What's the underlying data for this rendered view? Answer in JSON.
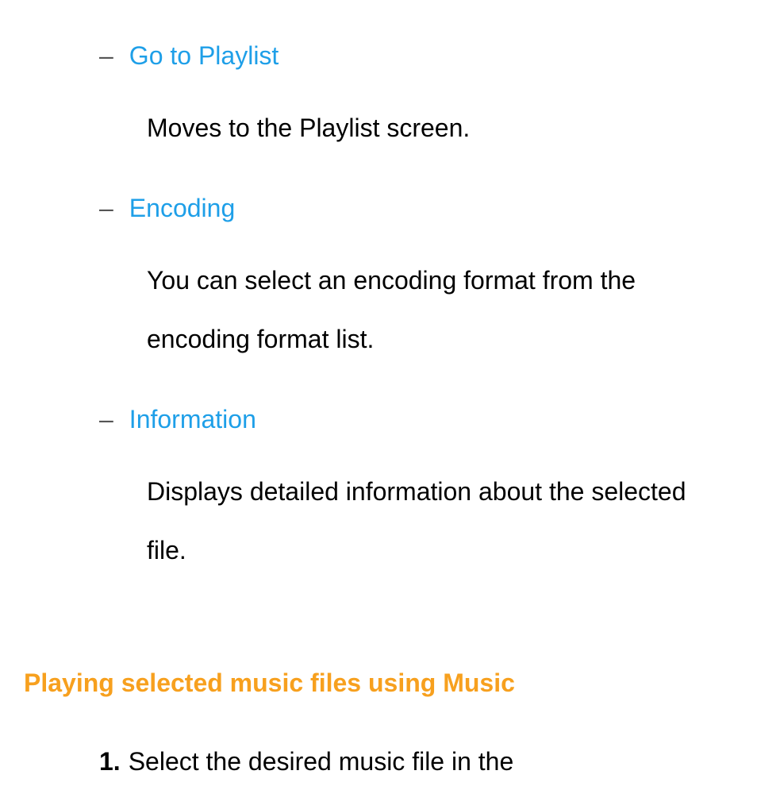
{
  "items": [
    {
      "title": "Go to Playlist",
      "description": "Moves to the Playlist screen."
    },
    {
      "title": "Encoding",
      "description": "You can select an encoding format from the encoding format list."
    },
    {
      "title": "Information",
      "description": "Displays detailed information about the selected file."
    }
  ],
  "section_heading": "Playing selected music files using Music",
  "step": {
    "number": "1.",
    "text": "Select the desired music file in the"
  },
  "dash": "–"
}
